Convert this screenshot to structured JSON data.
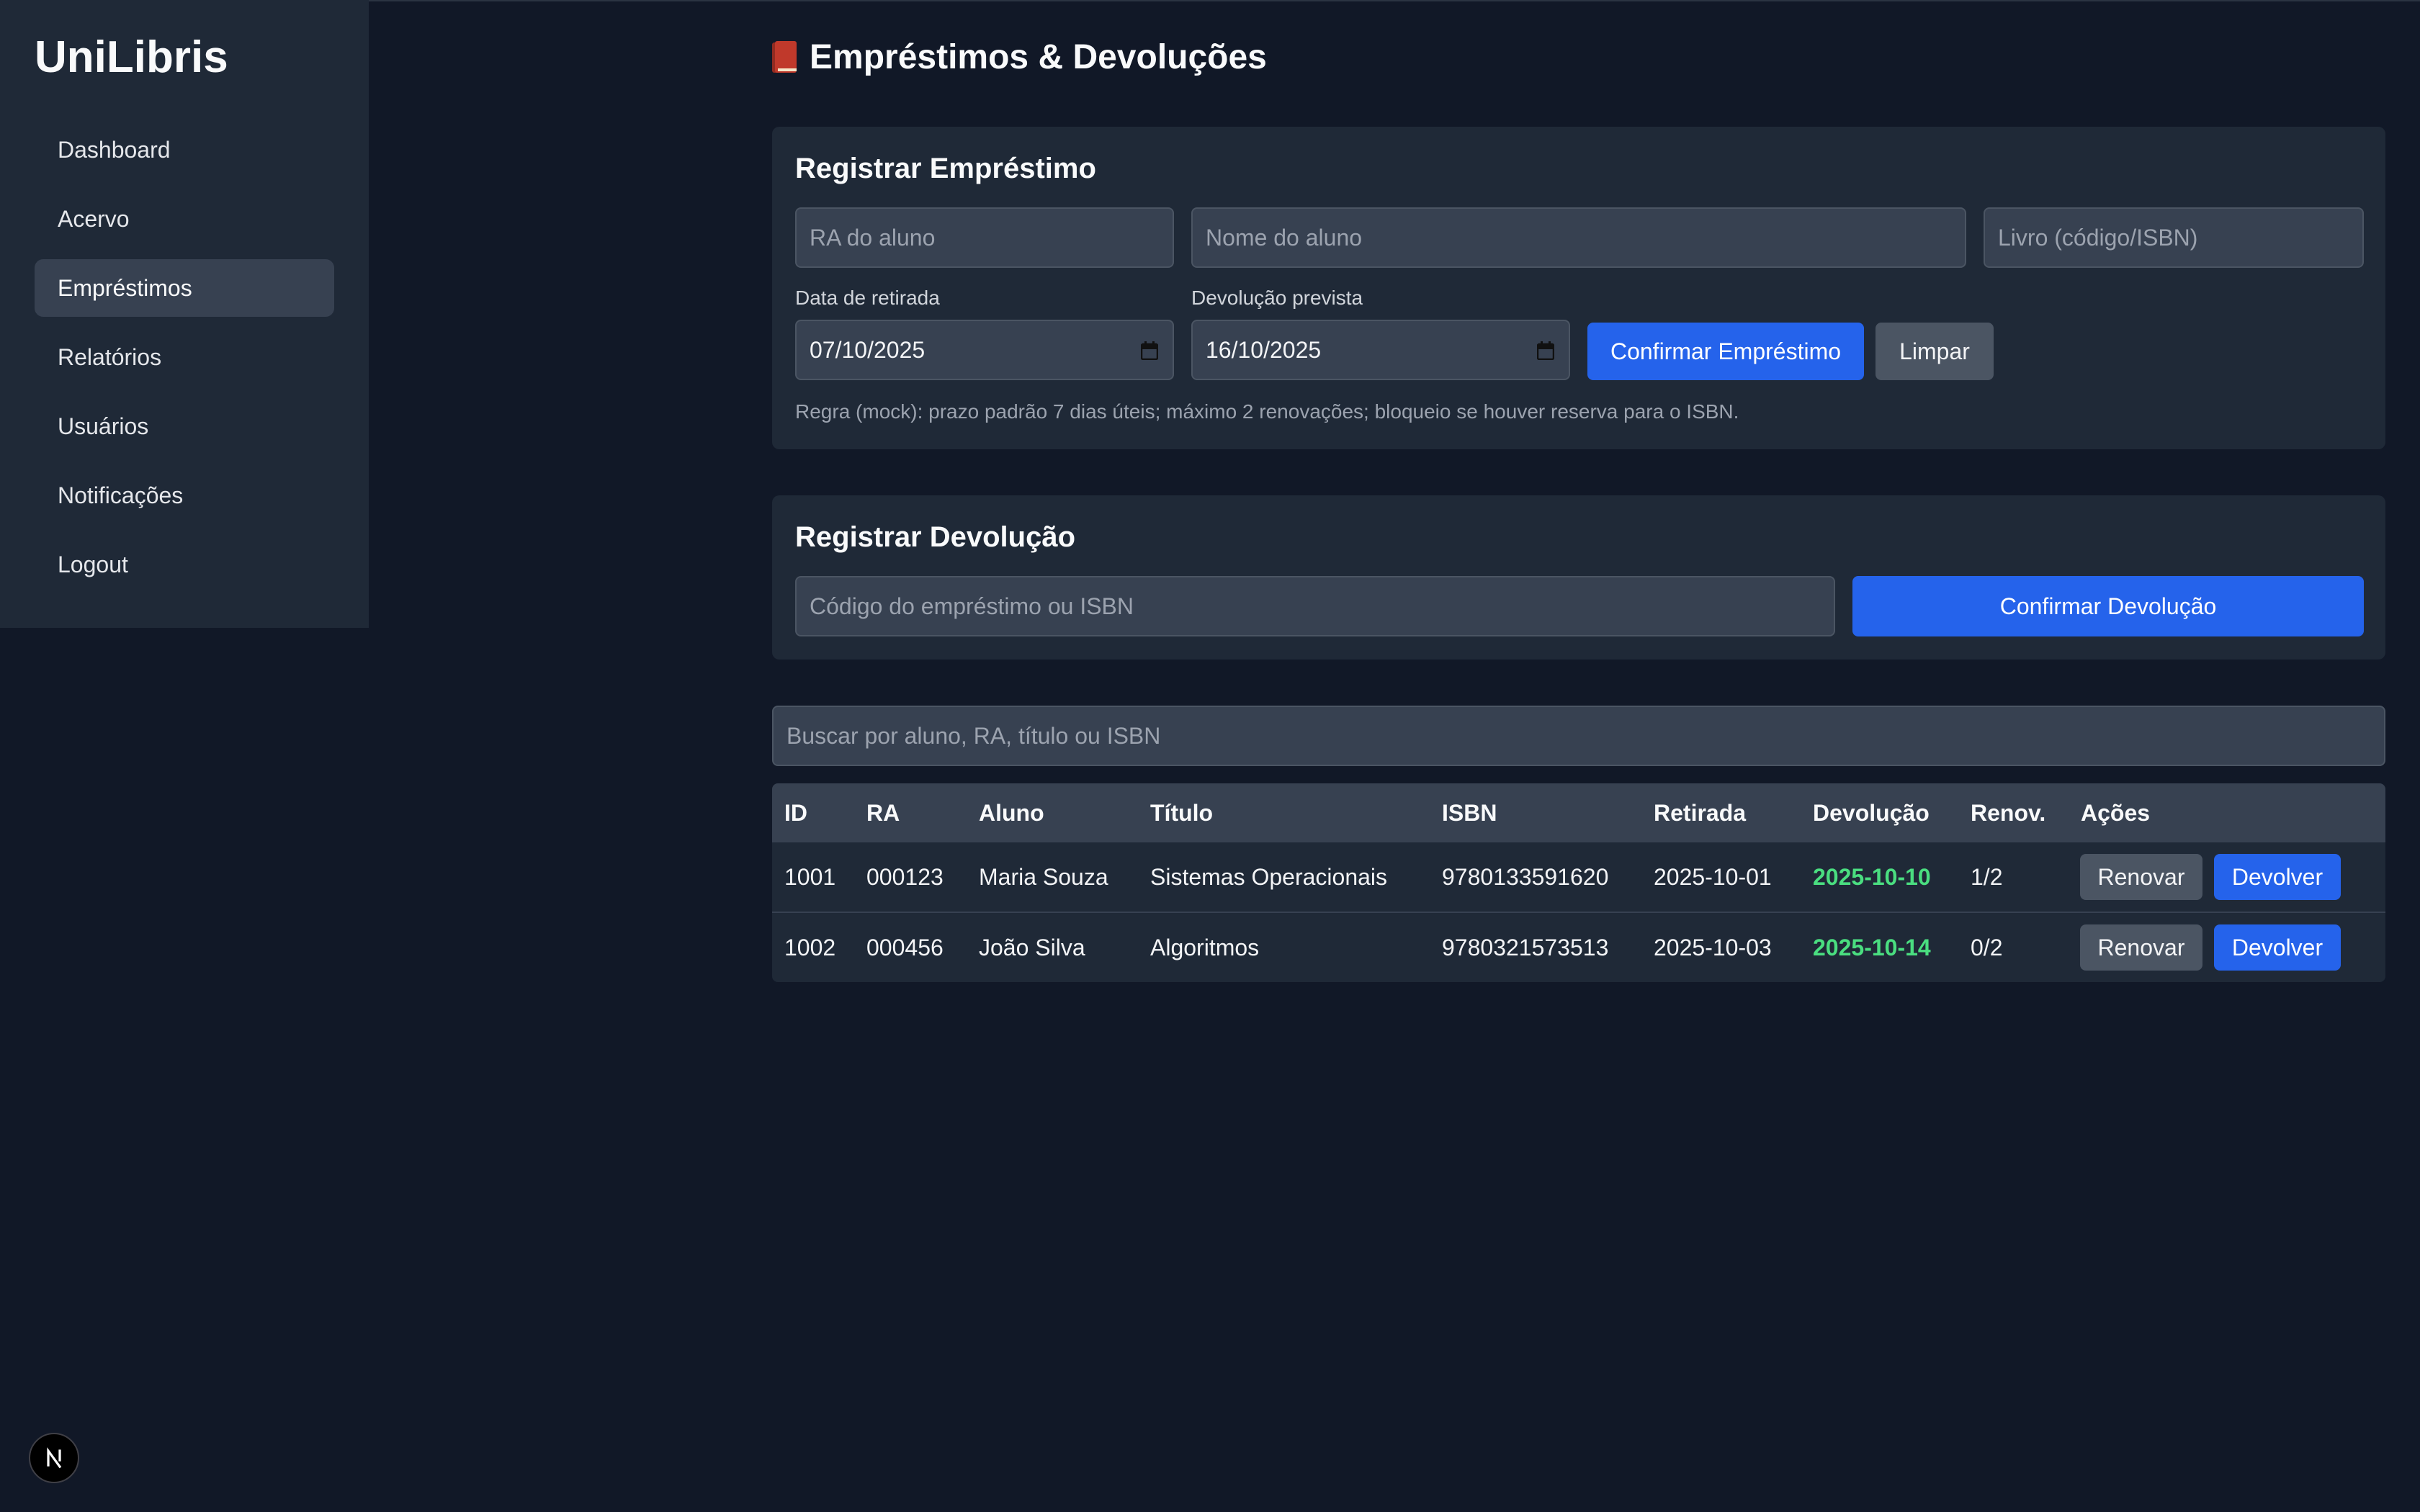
{
  "app": {
    "brand": "UniLibris"
  },
  "sidebar": {
    "items": [
      {
        "label": "Dashboard"
      },
      {
        "label": "Acervo"
      },
      {
        "label": "Empréstimos",
        "active": true
      },
      {
        "label": "Relatórios"
      },
      {
        "label": "Usuários"
      },
      {
        "label": "Notificações"
      },
      {
        "label": "Logout"
      }
    ]
  },
  "page": {
    "title": "Empréstimos & Devoluções",
    "title_icon": "book-icon"
  },
  "loan_form": {
    "title": "Registrar Empréstimo",
    "ra_placeholder": "RA do aluno",
    "name_placeholder": "Nome do aluno",
    "book_placeholder": "Livro (código/ISBN)",
    "pickup_label": "Data de retirada",
    "pickup_value": "07/10/2025",
    "due_label": "Devolução prevista",
    "due_value": "16/10/2025",
    "confirm_label": "Confirmar Empréstimo",
    "clear_label": "Limpar",
    "rule_text": "Regra (mock): prazo padrão 7 dias úteis; máximo 2 renovações; bloqueio se houver reserva para o ISBN."
  },
  "return_form": {
    "title": "Registrar Devolução",
    "code_placeholder": "Código do empréstimo ou ISBN",
    "confirm_label": "Confirmar Devolução"
  },
  "search": {
    "placeholder": "Buscar por aluno, RA, título ou ISBN"
  },
  "table": {
    "headers": [
      "ID",
      "RA",
      "Aluno",
      "Título",
      "ISBN",
      "Retirada",
      "Devolução",
      "Renov.",
      "Ações"
    ],
    "rows": [
      {
        "id": "1001",
        "ra": "000123",
        "aluno": "Maria Souza",
        "titulo": "Sistemas Operacionais",
        "isbn": "9780133591620",
        "retirada": "2025-10-01",
        "devolucao": "2025-10-10",
        "renov": "1/2"
      },
      {
        "id": "1002",
        "ra": "000456",
        "aluno": "João Silva",
        "titulo": "Algoritmos",
        "isbn": "9780321573513",
        "retirada": "2025-10-03",
        "devolucao": "2025-10-14",
        "renov": "0/2"
      }
    ],
    "renew_label": "Renovar",
    "return_label": "Devolver"
  },
  "colors": {
    "background": "#111827",
    "panel": "#1f2937",
    "accent": "#2563eb",
    "due_ok": "#4ade80"
  }
}
